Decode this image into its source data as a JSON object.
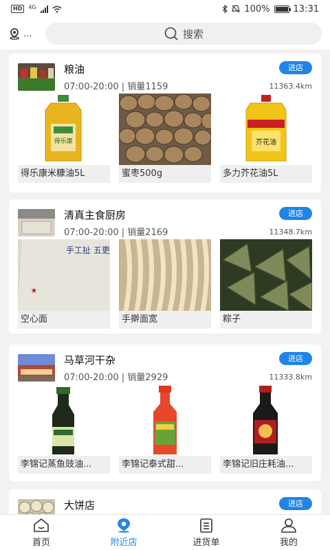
{
  "status": {
    "network": "4G",
    "hd": "HD",
    "battery": "100%",
    "time": "13:31"
  },
  "topbar": {
    "location_text": "...",
    "search_placeholder": "搜索"
  },
  "stores": [
    {
      "name": "粮油",
      "hours": "07:00-20:00",
      "sales": "销量1159",
      "distance": "11363.4km",
      "enter": "进店",
      "products": [
        {
          "name": "得乐康米糠油5L",
          "label": "得乐康"
        },
        {
          "name": "蜜枣500g"
        },
        {
          "name": "多力芥花油5L",
          "label": "芥花油"
        }
      ]
    },
    {
      "name": "清真主食厨房",
      "hours": "07:00-20:00",
      "sales": "销量2169",
      "distance": "11348.7km",
      "enter": "进店",
      "products": [
        {
          "name": "空心面",
          "label": "手工扯\n五更空心面"
        },
        {
          "name": "手擀面宽"
        },
        {
          "name": "粽子"
        }
      ]
    },
    {
      "name": "马草河干杂",
      "hours": "07:00-20:00",
      "sales": "销量2929",
      "distance": "11333.8km",
      "enter": "进店",
      "products": [
        {
          "name": "李锦记蒸鱼豉油..."
        },
        {
          "name": "李锦记泰式甜..."
        },
        {
          "name": "李锦记旧庄耗油..."
        }
      ]
    },
    {
      "name": "大饼店",
      "enter": "进店"
    }
  ],
  "tabs": [
    {
      "label": "首页",
      "icon": "home-icon"
    },
    {
      "label": "附近店",
      "icon": "nearby-pin-icon"
    },
    {
      "label": "进货单",
      "icon": "order-list-icon"
    },
    {
      "label": "我的",
      "icon": "user-icon"
    }
  ],
  "colors": {
    "accent": "#2184e7",
    "background": "#f2f2f2"
  }
}
